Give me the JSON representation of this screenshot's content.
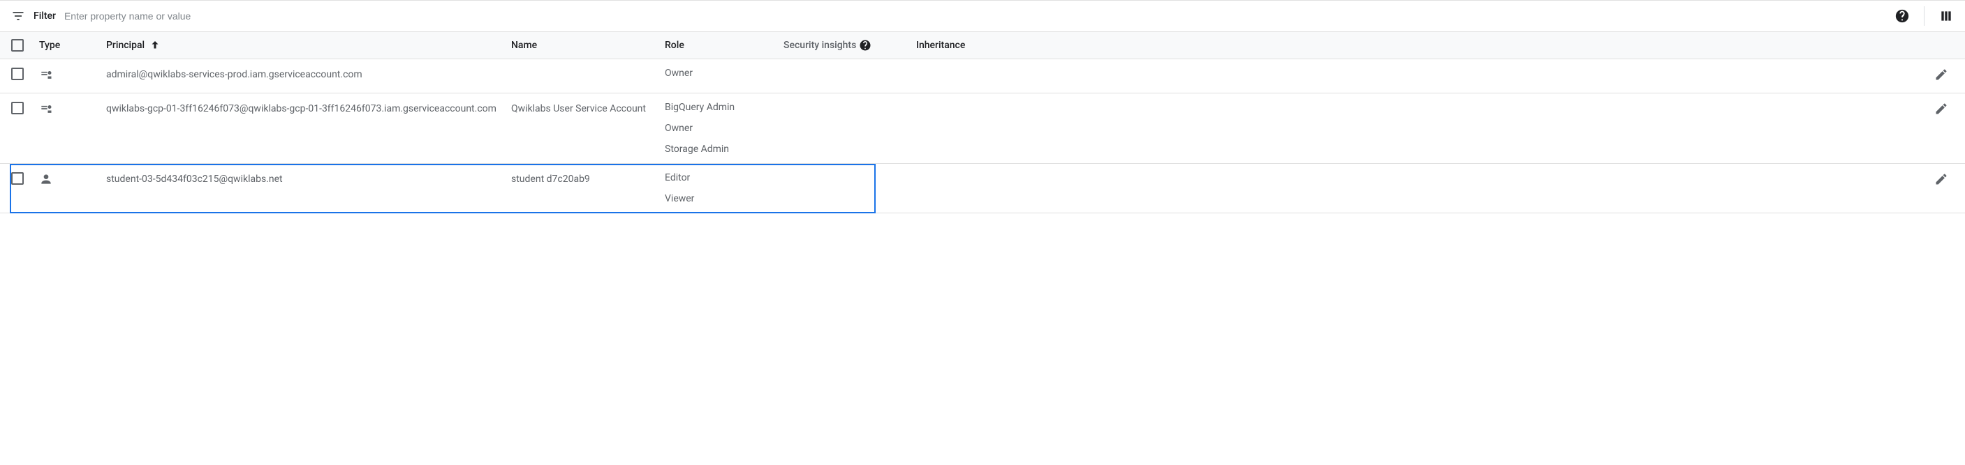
{
  "filter": {
    "label": "Filter",
    "placeholder": "Enter property name or value"
  },
  "headers": {
    "type": "Type",
    "principal": "Principal",
    "name": "Name",
    "role": "Role",
    "security": "Security insights",
    "inheritance": "Inheritance"
  },
  "rows": [
    {
      "principal": "admiral@qwiklabs-services-prod.iam.gserviceaccount.com",
      "name": "",
      "roles": [
        "Owner"
      ],
      "type_icon": "service-account"
    },
    {
      "principal": "qwiklabs-gcp-01-3ff16246f073@qwiklabs-gcp-01-3ff16246f073.iam.gserviceaccount.com",
      "name": "Qwiklabs User Service Account",
      "roles": [
        "BigQuery Admin",
        "Owner",
        "Storage Admin"
      ],
      "type_icon": "service-account"
    },
    {
      "principal": "student-03-5d434f03c215@qwiklabs.net",
      "name": "student d7c20ab9",
      "roles": [
        "Editor",
        "Viewer"
      ],
      "type_icon": "user"
    }
  ]
}
